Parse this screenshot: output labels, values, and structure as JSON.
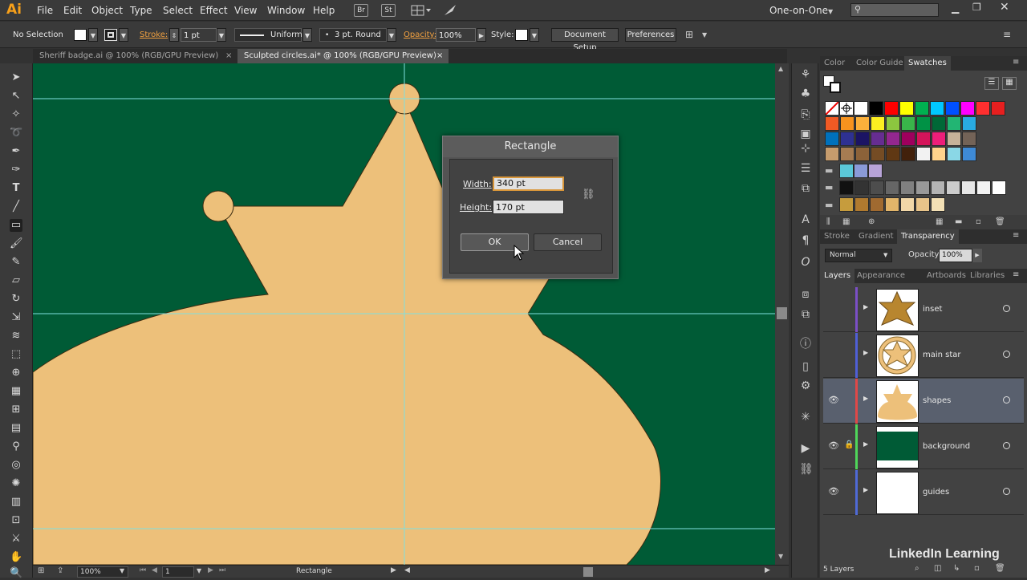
{
  "app": {
    "logo": "Ai"
  },
  "menu": [
    "File",
    "Edit",
    "Object",
    "Type",
    "Select",
    "Effect",
    "View",
    "Window",
    "Help"
  ],
  "menu_icons": {
    "bridge": "Br",
    "stock": "St"
  },
  "workspace": {
    "label": "One-on-One",
    "search_placeholder": ""
  },
  "control": {
    "selection": "No Selection",
    "stroke_label": "Stroke:",
    "stroke_weight": "1 pt",
    "profile": "Uniform",
    "brush": "3 pt. Round",
    "opacity_label": "Opacity:",
    "opacity": "100%",
    "style_label": "Style:",
    "document_setup": "Document Setup",
    "preferences": "Preferences"
  },
  "tabs": [
    {
      "label": "Sheriff badge.ai @ 100% (RGB/GPU Preview)",
      "close": "×"
    },
    {
      "label": "Sculpted circles.ai* @ 100% (RGB/GPU Preview)",
      "close": "×"
    }
  ],
  "dialog": {
    "title": "Rectangle",
    "width_label": "Width:",
    "width_value": "340 pt",
    "height_label": "Height:",
    "height_value": "170 pt",
    "ok": "OK",
    "cancel": "Cancel"
  },
  "panels": {
    "top_tabs": [
      "Color",
      "Color Guide",
      "Swatches"
    ],
    "middle_tabs": [
      "Stroke",
      "Gradient",
      "Transparency"
    ],
    "blend_mode": "Normal",
    "opacity_label": "Opacity:",
    "opacity_value": "100%",
    "layer_tabs": [
      "Layers",
      "Appearance",
      "Artboards",
      "Libraries"
    ],
    "layers_count": "5 Layers"
  },
  "layers": [
    {
      "name": "inset",
      "color": "#7b4fc6",
      "visible": false,
      "locked": false,
      "selected": false
    },
    {
      "name": "main star",
      "color": "#4f5fd6",
      "visible": false,
      "locked": false,
      "selected": false
    },
    {
      "name": "shapes",
      "color": "#e04848",
      "visible": true,
      "locked": false,
      "selected": true
    },
    {
      "name": "background",
      "color": "#4fd65a",
      "visible": true,
      "locked": true,
      "selected": false
    },
    {
      "name": "guides",
      "color": "#4f6ad6",
      "visible": true,
      "locked": false,
      "selected": false
    }
  ],
  "swatch_rows": [
    [
      "#ffffff",
      "#000000",
      "#ff0000",
      "#ffff00",
      "#00b050",
      "#00c8ff",
      "#0050ff",
      "#ff00ff",
      "#ff2f2f",
      "#e61f1f"
    ],
    [
      "#f15a24",
      "#f7931e",
      "#fbb03b",
      "#fcee21",
      "#8cc63f",
      "#39b54a",
      "#009245",
      "#006837",
      "#22b573",
      "#29abe2"
    ],
    [
      "#0071bc",
      "#2e3192",
      "#1b1464",
      "#662d91",
      "#93278f",
      "#9e005d",
      "#d4145a",
      "#ed1e79",
      "#c7b299",
      "#736357"
    ],
    [
      "#c69c6d",
      "#a67c52",
      "#8c6239",
      "#754c24",
      "#603813",
      "#42210b",
      "#f2f2f2",
      "#ffd38c",
      "#8ad7e6",
      "#3e8ad6"
    ]
  ],
  "status": {
    "zoom": "100%",
    "artboard": "1",
    "tool": "Rectangle"
  },
  "watermark": "LinkedIn Learning",
  "colors": {
    "canvas": "#005b36",
    "shape": "#edc07a",
    "guide": "#7fe0e0",
    "accent": "#d8963a"
  }
}
